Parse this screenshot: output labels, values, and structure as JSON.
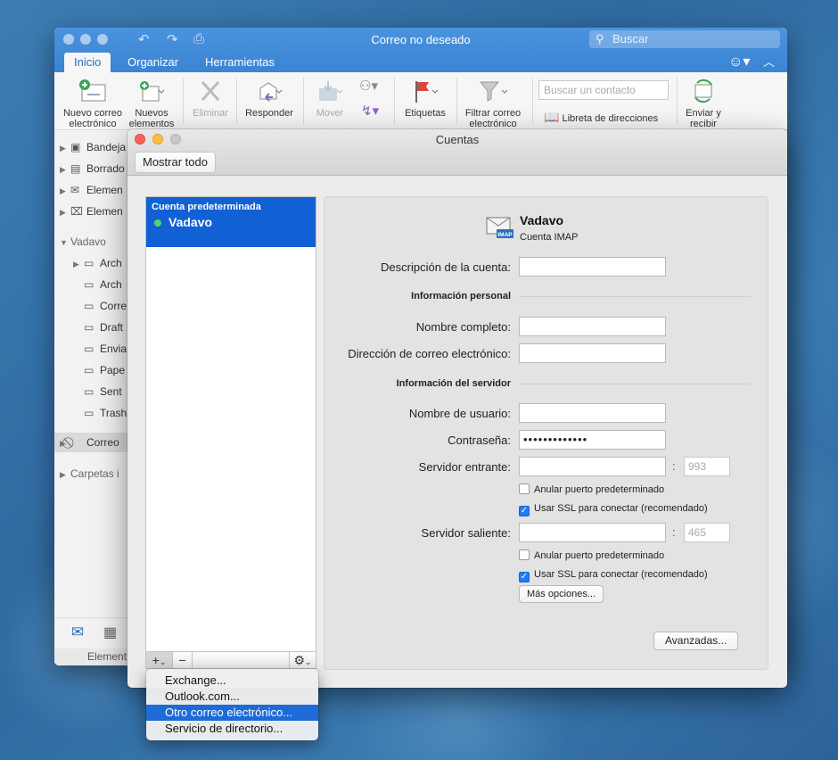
{
  "window": {
    "title": "Correo no deseado",
    "search_placeholder": "Buscar",
    "tabs": [
      "Inicio",
      "Organizar",
      "Herramientas"
    ]
  },
  "ribbon": {
    "new_email": [
      "Nuevo correo",
      "electrónico"
    ],
    "new_items": [
      "Nuevos",
      "elementos"
    ],
    "delete": "Eliminar",
    "reply": "Responder",
    "move": "Mover",
    "tags": "Etiquetas",
    "filter": [
      "Filtrar correo",
      "electrónico"
    ],
    "contact_search_placeholder": "Buscar un contacto",
    "address_book": "Libreta de direcciones",
    "send_receive": [
      "Enviar y",
      "recibir"
    ]
  },
  "sidebar": {
    "items": [
      {
        "label": "Bandeja",
        "icon": "inbox-icon"
      },
      {
        "label": "Borrado",
        "icon": "drafts-icon"
      },
      {
        "label": "Elemen",
        "icon": "sent-icon"
      },
      {
        "label": "Elemen",
        "icon": "deleted-icon"
      }
    ],
    "account": "Vadavo",
    "folders": [
      "Arch",
      "Arch",
      "Corre",
      "Draft",
      "Envia",
      "Pape",
      "Sent",
      "Trash"
    ],
    "junk": "Correo",
    "other": "Carpetas i",
    "status": "Element"
  },
  "dialog": {
    "title": "Cuentas",
    "show_all": "Mostrar todo",
    "account_list": [
      {
        "kind": "Cuenta predeterminada",
        "name": "Vadavo",
        "status_color": "#4cd964"
      }
    ],
    "detail": {
      "name": "Vadavo",
      "type": "Cuenta IMAP",
      "icon_badge": "IMAP",
      "description_label": "Descripción de la cuenta:",
      "description_value": "",
      "personal_section": "Información personal",
      "full_name_label": "Nombre completo:",
      "full_name_value": "",
      "email_label": "Dirección de correo electrónico:",
      "email_value": "",
      "server_section": "Información del servidor",
      "username_label": "Nombre de usuario:",
      "username_value": "",
      "password_label": "Contraseña:",
      "password_value": "•••••••••••••",
      "incoming_label": "Servidor entrante:",
      "incoming_value": "",
      "incoming_port_placeholder": "993",
      "incoming_override": "Anular puerto predeterminado",
      "incoming_ssl": "Usar SSL para conectar (recomendado)",
      "outgoing_label": "Servidor saliente:",
      "outgoing_value": "",
      "outgoing_port_placeholder": "465",
      "outgoing_override": "Anular puerto predeterminado",
      "outgoing_ssl": "Usar SSL para conectar (recomendado)",
      "more_options": "Más opciones...",
      "advanced": "Avanzadas..."
    }
  },
  "add_menu": {
    "items": [
      "Exchange...",
      "Outlook.com...",
      "Otro correo electrónico...",
      "Servicio de directorio..."
    ],
    "highlighted_index": 2
  },
  "colors": {
    "titlebar": "#3b84d3",
    "selection": "#1160d4",
    "menu_highlight": "#1d6bd8"
  }
}
